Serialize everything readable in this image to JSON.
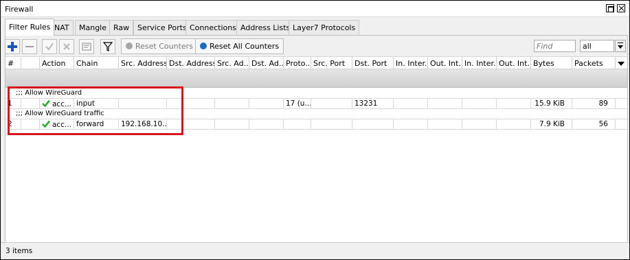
{
  "window": {
    "title": "Firewall"
  },
  "tabs": [
    {
      "label": "Filter Rules",
      "active": true
    },
    {
      "label": "NAT"
    },
    {
      "label": "Mangle"
    },
    {
      "label": "Raw"
    },
    {
      "label": "Service Ports"
    },
    {
      "label": "Connections"
    },
    {
      "label": "Address Lists"
    },
    {
      "label": "Layer7 Protocols"
    }
  ],
  "toolbar": {
    "add_icon": "plus-icon",
    "remove_icon": "minus-icon",
    "enable_icon": "check-icon",
    "disable_icon": "x-icon",
    "comment_icon": "comment-icon",
    "filter_icon": "funnel-icon",
    "reset_counters_label": "Reset Counters",
    "reset_all_counters_label": "Reset All Counters",
    "find_placeholder": "Find",
    "scope_value": "all",
    "accent_color": "#1a57b4"
  },
  "table": {
    "columns": [
      "#",
      "",
      "Action",
      "Chain",
      "Src. Address",
      "Dst. Address",
      "Src. Ad...",
      "Dst. Ad...",
      "Proto...",
      "Src. Port",
      "Dst. Port",
      "In. Inter...",
      "Out. Int...",
      "In. Inter...",
      "Out. Int...",
      "Bytes",
      "Packets"
    ],
    "rows": [
      {
        "comment": ";;; Allow WireGuard",
        "num": "1",
        "action": "acc...",
        "chain": "input",
        "src_address": "",
        "dst_address": "",
        "src_address_list": "",
        "dst_address_list": "",
        "protocol": "17 (u...",
        "src_port": "",
        "dst_port": "13231",
        "in_interface": "",
        "out_interface": "",
        "in_interface_list": "",
        "out_interface_list": "",
        "bytes": "15.9 KiB",
        "packets": "89"
      },
      {
        "comment": ";;; Allow WireGuard traffic",
        "num": "2",
        "action": "acc...",
        "chain": "forward",
        "src_address": "192.168.10...",
        "dst_address": "",
        "src_address_list": "",
        "dst_address_list": "",
        "protocol": "",
        "src_port": "",
        "dst_port": "",
        "in_interface": "",
        "out_interface": "",
        "in_interface_list": "",
        "out_interface_list": "",
        "bytes": "7.9 KiB",
        "packets": "56"
      }
    ],
    "action_icon": "green-check-icon",
    "highlight_color": "#d8121a"
  },
  "status": {
    "text": "3 items"
  }
}
